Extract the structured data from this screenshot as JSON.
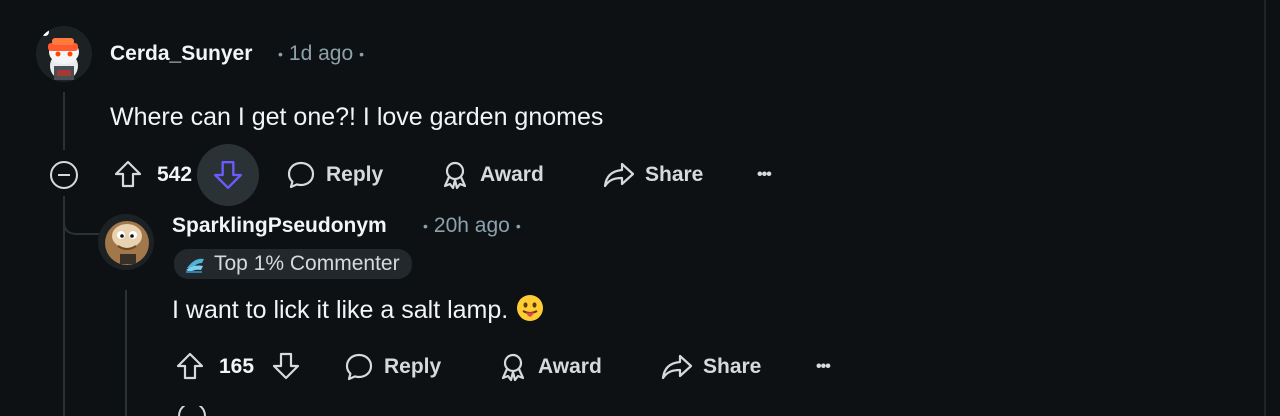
{
  "comment1": {
    "username": "Cerda_Sunyer",
    "time": "1d ago",
    "text": "Where can I get one?! I love garden gnomes",
    "score": "542",
    "reply_label": "Reply",
    "award_label": "Award",
    "share_label": "Share",
    "more_label": "•••"
  },
  "comment2": {
    "username": "SparklingPseudonym",
    "time": "20h ago",
    "flair": "Top 1% Commenter",
    "text": "I want to lick it like a salt lamp.",
    "score": "165",
    "reply_label": "Reply",
    "award_label": "Award",
    "share_label": "Share",
    "more_label": "•••"
  },
  "colors": {
    "background": "#0e1113",
    "text": "#f2f4f5",
    "meta": "#8ba2ad",
    "downvote_active": "#6a5cff",
    "thread_line": "#2b3236"
  },
  "icons": {
    "collapse": "collapse-icon",
    "upvote": "upvote-icon",
    "downvote": "downvote-icon",
    "reply": "comment-bubble-icon",
    "award": "award-icon",
    "share": "share-icon",
    "more": "more-icon",
    "flair": "flair-badge-icon",
    "emoji": "tongue-out-emoji-icon"
  }
}
